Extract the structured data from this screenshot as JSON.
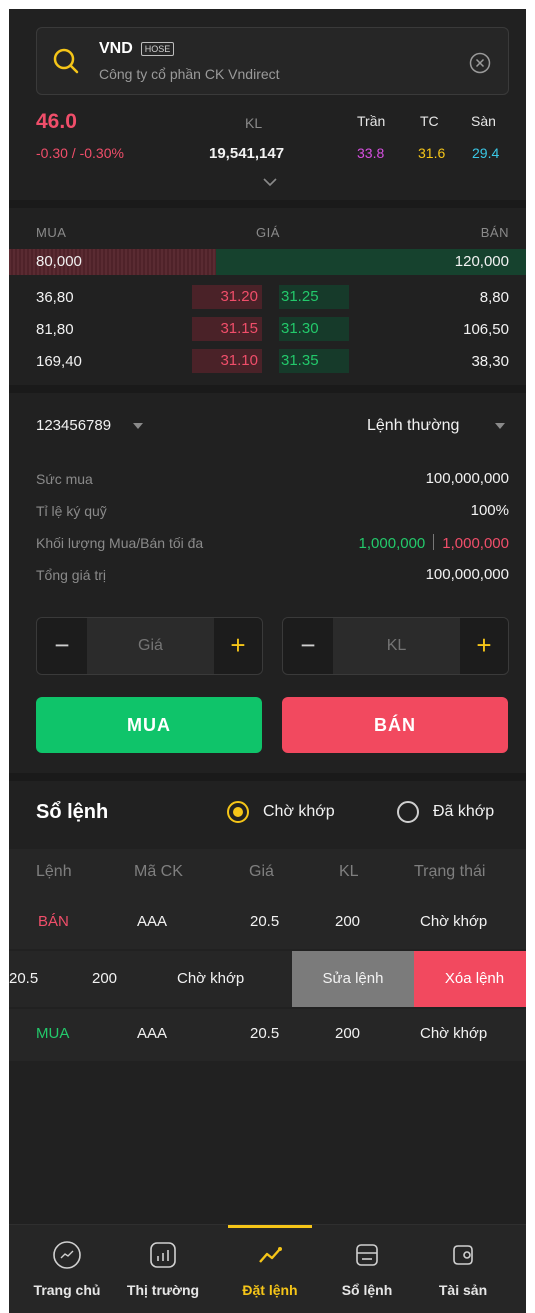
{
  "symbol": {
    "code": "VND",
    "exchange": "HOSE",
    "company": "Công ty cổ phần CK Vndirect"
  },
  "quote": {
    "price": "46.0",
    "change": "-0.30 / -0.30%",
    "volume_label": "KL",
    "volume": "19,541,147",
    "ceiling_label": "Trần",
    "ceiling": "33.8",
    "ref_label": "TC",
    "ref": "31.6",
    "floor_label": "Sàn",
    "floor": "29.4"
  },
  "orderbook": {
    "buy_header": "MUA",
    "price_header": "GIÁ",
    "sell_header": "BÁN",
    "total_buy": "80,000",
    "total_sell": "120,000",
    "buy_fraction": 0.4,
    "rows": [
      {
        "buy_qty": "36,80",
        "buy_price": "31.20",
        "ask_price": "31.25",
        "sell_qty": "8,80"
      },
      {
        "buy_qty": "81,80",
        "buy_price": "31.15",
        "ask_price": "31.30",
        "sell_qty": "106,50"
      },
      {
        "buy_qty": "169,40",
        "buy_price": "31.10",
        "ask_price": "31.35",
        "sell_qty": "38,30"
      }
    ]
  },
  "account": {
    "number": "123456789",
    "order_type": "Lệnh thường",
    "buying_power_label": "Sức mua",
    "buying_power": "100,000,000",
    "margin_label": "Tỉ lệ ký quỹ",
    "margin": "100%",
    "max_qty_label": "Khối lượng Mua/Bán tối đa",
    "max_buy": "1,000,000",
    "max_sell": "1,000,000",
    "total_label": "Tổng giá trị",
    "total": "100,000,000"
  },
  "form": {
    "price_placeholder": "Giá",
    "qty_placeholder": "KL",
    "minus": "−",
    "plus": "+",
    "buy_label": "MUA",
    "sell_label": "BÁN"
  },
  "orders": {
    "title": "Sổ lệnh",
    "filter_pending": "Chờ khớp",
    "filter_matched": "Đã khớp",
    "columns": [
      "Lệnh",
      "Mã CK",
      "Giá",
      "KL",
      "Trạng thái"
    ],
    "rows": [
      {
        "side": "BÁN",
        "code": "AAA",
        "price": "20.5",
        "qty": "200",
        "status": "Chờ khớp"
      },
      {
        "side": "MUA",
        "code": "AAA",
        "price": "20.5",
        "qty": "200",
        "status": "Chờ khớp"
      }
    ],
    "swiped": {
      "price": "20.5",
      "qty": "200",
      "status": "Chờ khớp",
      "edit_label": "Sửa lệnh",
      "delete_label": "Xóa lệnh"
    }
  },
  "nav": [
    {
      "label": "Trang chủ",
      "icon": "home-icon"
    },
    {
      "label": "Thị trường",
      "icon": "market-icon"
    },
    {
      "label": "Đặt lệnh",
      "icon": "trade-icon"
    },
    {
      "label": "Sổ lệnh",
      "icon": "orderbook-icon"
    },
    {
      "label": "Tài sản",
      "icon": "wallet-icon"
    }
  ],
  "colors": {
    "accent": "#f5c518",
    "up": "#23c96b",
    "down": "#f04e6a",
    "ceiling": "#d64fe0",
    "floor": "#3ac8e6"
  }
}
